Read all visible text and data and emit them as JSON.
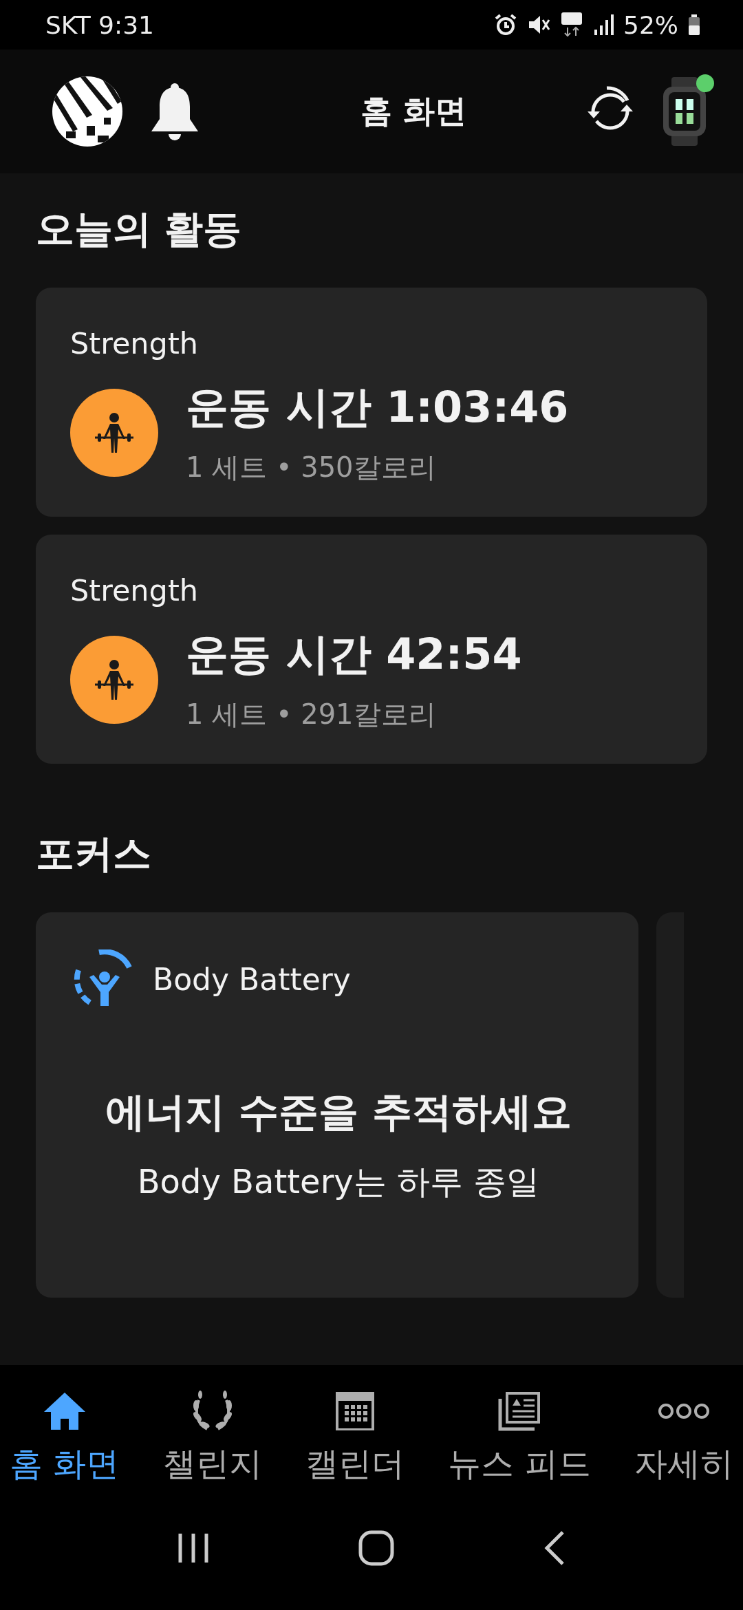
{
  "status_bar": {
    "carrier_time": "SKT 9:31",
    "battery": "52%"
  },
  "header": {
    "title": "홈 화면",
    "device_connected": true
  },
  "activity": {
    "title": "오늘의 활동",
    "items": [
      {
        "type": "Strength",
        "duration": "운동 시간 1:03:46",
        "details": "1 세트 • 350칼로리"
      },
      {
        "type": "Strength",
        "duration": "운동 시간 42:54",
        "details": "1 세트 • 291칼로리"
      }
    ]
  },
  "focus": {
    "title": "포커스",
    "card": {
      "label": "Body Battery",
      "heading": "에너지 수준을 추적하세요",
      "text": "Body Battery는 하루 종일"
    }
  },
  "nav": [
    {
      "kind": "home",
      "label": "홈 화면",
      "selected": true
    },
    {
      "kind": "challenge",
      "label": "챌린지",
      "selected": false
    },
    {
      "kind": "calendar",
      "label": "캘린더",
      "selected": false
    },
    {
      "kind": "news",
      "label": "뉴스 피드",
      "selected": false
    },
    {
      "kind": "more",
      "label": "자세히",
      "selected": false
    }
  ]
}
